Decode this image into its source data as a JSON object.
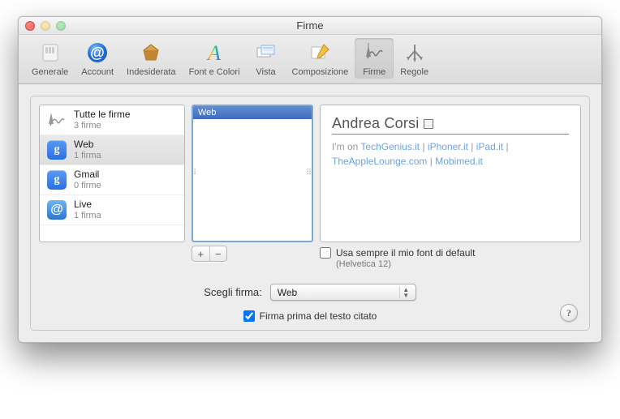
{
  "window": {
    "title": "Firme"
  },
  "toolbar": [
    {
      "key": "generale",
      "label": "Generale"
    },
    {
      "key": "account",
      "label": "Account"
    },
    {
      "key": "indesiderata",
      "label": "Indesiderata"
    },
    {
      "key": "font",
      "label": "Font e Colori"
    },
    {
      "key": "vista",
      "label": "Vista"
    },
    {
      "key": "composizione",
      "label": "Composizione"
    },
    {
      "key": "firme",
      "label": "Firme",
      "active": true
    },
    {
      "key": "regole",
      "label": "Regole"
    }
  ],
  "accounts": [
    {
      "name": "Tutte le firme",
      "sub": "3 firme",
      "icon": "pen"
    },
    {
      "name": "Web",
      "sub": "1 firma",
      "icon": "g",
      "selected": true
    },
    {
      "name": "Gmail",
      "sub": "0 firme",
      "icon": "g"
    },
    {
      "name": "Live",
      "sub": "1 firma",
      "icon": "at"
    }
  ],
  "signatures": [
    {
      "name": "Web",
      "selected": true
    }
  ],
  "buttons": {
    "add": "+",
    "remove": "−"
  },
  "preview": {
    "name": "Andrea Corsi",
    "prefix": "I'm on ",
    "links": [
      "TechGenius.it",
      "iPhoner.it",
      "iPad.it",
      "TheAppleLounge.com",
      "Mobimed.it"
    ],
    "sep": " | "
  },
  "default_font": {
    "checkbox_label": "Usa sempre il mio font di default",
    "subtext": "(Helvetica 12)",
    "checked": false
  },
  "choose": {
    "label": "Scegli firma:",
    "value": "Web"
  },
  "before_quoted": {
    "label": "Firma prima del testo citato",
    "checked": true
  },
  "help": "?"
}
